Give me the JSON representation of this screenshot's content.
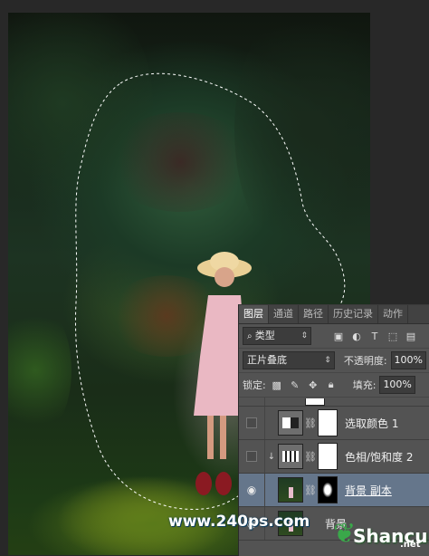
{
  "panel": {
    "tabs": [
      "图层",
      "通道",
      "路径",
      "历史记录",
      "动作"
    ],
    "active_tab": 0,
    "filter_select": "类型",
    "filter_icons": [
      "image-filter-icon",
      "adjustment-filter-icon",
      "type-filter-icon",
      "shape-filter-icon",
      "smartobject-filter-icon"
    ],
    "blend_mode": "正片叠底",
    "opacity_label": "不透明度:",
    "opacity_value": "100%",
    "lock_label": "锁定:",
    "fill_label": "填充:",
    "fill_value": "100%",
    "layers": [
      {
        "name": "选取颜色 1",
        "visible": false,
        "clipped": false,
        "type": "selective-color"
      },
      {
        "name": "色相/饱和度 2",
        "visible": false,
        "clipped": true,
        "type": "hue-saturation"
      },
      {
        "name": "背景 副本",
        "visible": true,
        "clipped": false,
        "type": "image-with-mask",
        "selected": true
      },
      {
        "name": "背景",
        "visible": true,
        "clipped": false,
        "type": "image"
      }
    ]
  },
  "watermarks": {
    "site": "www.240ps.com",
    "brand": "Shancun",
    "brand_tld": ".net"
  },
  "colors": {
    "panel_bg": "#535353",
    "selected_layer": "#65768b",
    "workspace_bg": "#282828"
  }
}
